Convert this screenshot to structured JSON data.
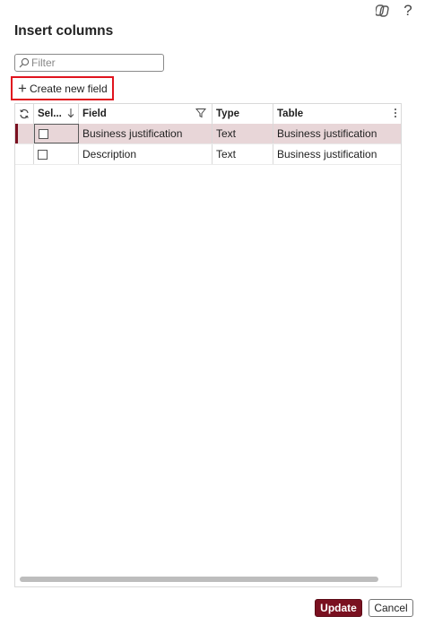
{
  "header": {
    "title": "Insert columns"
  },
  "top_icons": {
    "copilot_icon": "copilot-icon",
    "help_glyph": "?"
  },
  "filter": {
    "placeholder": "Filter"
  },
  "toolbar": {
    "create_label": "Create new field",
    "create_glyph": "+"
  },
  "grid": {
    "columns": {
      "select": "Sel...",
      "field": "Field",
      "type": "Type",
      "table": "Table"
    },
    "rows": [
      {
        "field": "Business justification",
        "type": "Text",
        "table": "Business justification",
        "selected": true
      },
      {
        "field": "Description",
        "type": "Text",
        "table": "Business justification",
        "selected": false
      }
    ]
  },
  "footer": {
    "update_label": "Update",
    "cancel_label": "Cancel"
  },
  "colors": {
    "accent": "#7a1020",
    "highlight_outline": "#e0141e",
    "row_selected_bg": "#e8d6d8"
  }
}
